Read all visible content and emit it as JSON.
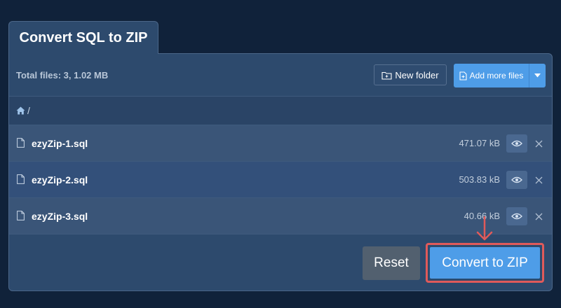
{
  "tab": {
    "title": "Convert SQL to ZIP"
  },
  "toolbar": {
    "total_files": "Total files: 3, 1.02 MB",
    "new_folder_label": "New folder",
    "add_more_label": "Add more files"
  },
  "breadcrumb": {
    "path": "/"
  },
  "files": [
    {
      "name": "ezyZip-1.sql",
      "size": "471.07 kB"
    },
    {
      "name": "ezyZip-2.sql",
      "size": "503.83 kB"
    },
    {
      "name": "ezyZip-3.sql",
      "size": "40.66 kB"
    }
  ],
  "actions": {
    "reset_label": "Reset",
    "convert_label": "Convert to ZIP"
  },
  "icons": {
    "home": "home-icon",
    "folder": "folder-plus-icon",
    "file_add": "file-add-icon",
    "file": "file-icon",
    "eye": "eye-icon",
    "close": "close-icon",
    "caret": "caret-down-icon",
    "arrow": "arrow-down-icon"
  },
  "colors": {
    "background": "#10223a",
    "panel": "#2d4a6d",
    "accent": "#4e9de8",
    "reset": "#52606f",
    "highlight": "#e05a5a"
  }
}
